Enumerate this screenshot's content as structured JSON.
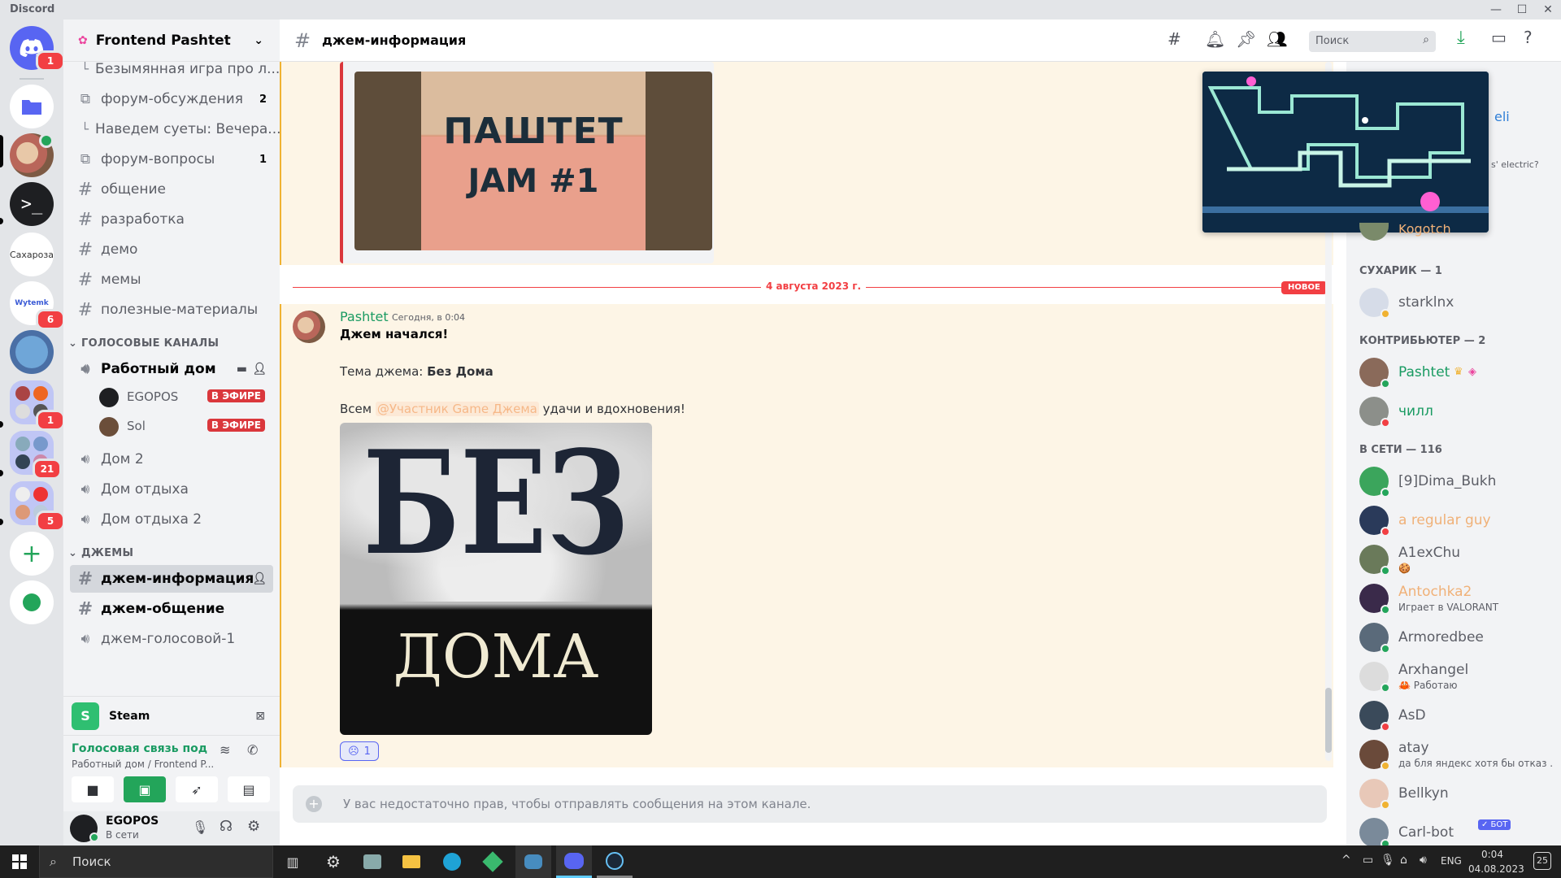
{
  "window": {
    "title": "Discord"
  },
  "rail": {
    "home_badge": "1",
    "servers": [
      {
        "label": "Сахароза"
      },
      {
        "label": "Wytemk",
        "badge": "6"
      }
    ],
    "badges": [
      "1",
      "21",
      "5"
    ]
  },
  "server": {
    "name": "Frontend Pashtet"
  },
  "channels": {
    "top": [
      {
        "icon": "thread",
        "label": "Безымянная игра про л..."
      },
      {
        "icon": "forum",
        "label": "форум-обсуждения",
        "count": "2"
      },
      {
        "icon": "thread",
        "label": "Наведем суеты: Вечера..."
      },
      {
        "icon": "forum",
        "label": "форум-вопросы",
        "count": "1"
      },
      {
        "icon": "text",
        "label": "общение"
      },
      {
        "icon": "text",
        "label": "разработка"
      },
      {
        "icon": "text",
        "label": "демо"
      },
      {
        "icon": "text",
        "label": "мемы"
      },
      {
        "icon": "text",
        "label": "полезные-материалы"
      }
    ],
    "voice_category": "ГОЛОСОВЫЕ КАНАЛЫ",
    "voice": [
      {
        "label": "Работный дом",
        "users": [
          {
            "name": "EGOPOS",
            "status": "В ЭФИРЕ"
          },
          {
            "name": "Sol",
            "status": "В ЭФИРЕ"
          }
        ]
      },
      {
        "label": "Дом 2"
      },
      {
        "label": "Дом отдыха"
      },
      {
        "label": "Дом отдыха 2"
      }
    ],
    "jam_category": "ДЖЕМЫ",
    "jam": [
      {
        "icon": "text",
        "label": "джем-информация",
        "active": true
      },
      {
        "icon": "text",
        "label": "джем-общение"
      },
      {
        "icon": "voice",
        "label": "джем-голосовой-1"
      }
    ]
  },
  "activity": {
    "label": "Steam"
  },
  "voice_panel": {
    "status": "Голосовая связь под",
    "location": "Работный дом / Frontend P..."
  },
  "user": {
    "name": "EGOPOS",
    "status": "В сети"
  },
  "header": {
    "channel": "джем-информация",
    "search_placeholder": "Поиск"
  },
  "messages": {
    "embed_title_line1": "ПАШТЕТ",
    "embed_title_line2": "JAM #1",
    "divider_date": "4 августа 2023 г.",
    "new_label": "НОВОЕ",
    "author": "Pashtet",
    "timestamp": "Сегодня, в 0:04",
    "line1": "Джем начался!",
    "line2_prefix": "Тема джема:",
    "line2_bold": "Без Дома",
    "line3_prefix": "Всем",
    "mention": "@Участник Game Джема",
    "line3_suffix": "удачи и вдохновения!",
    "image_top": "БЕЗ",
    "image_bottom": "ДОМА",
    "reaction_count": "1",
    "input_placeholder": "У вас недостаточно прав, чтобы отправлять сообщения на этом канале."
  },
  "pip": {
    "overlay_name": "eli",
    "overlay_text": "s' electric?",
    "overlay_member": "Kogotch"
  },
  "members": {
    "sections": [
      {
        "title": "СУХАРИК — 1",
        "items": [
          {
            "name": "starklnx",
            "color": "#5c5e66",
            "status": "idle"
          }
        ]
      },
      {
        "title": "КОНТРИБЬЮТЕР — 2",
        "items": [
          {
            "name": "Pashtet",
            "color": "#1a9b62",
            "status": "online"
          },
          {
            "name": "чилл",
            "color": "#1a9b62",
            "status": "dnd"
          }
        ]
      },
      {
        "title": "В СЕТИ — 116",
        "items": [
          {
            "name": "[9]Dima_Bukh",
            "color": "#5c5e66",
            "status": "online"
          },
          {
            "name": "a regular guy",
            "color": "#f0b178",
            "status": "dnd"
          },
          {
            "name": "A1exChu",
            "color": "#5c5e66",
            "status": "online",
            "sub": "🍪"
          },
          {
            "name": "Antochka2",
            "color": "#f0b178",
            "status": "online",
            "sub": "Играет в VALORANT"
          },
          {
            "name": "Armoredbee",
            "color": "#5c5e66",
            "status": "online"
          },
          {
            "name": "Arxhangel",
            "color": "#5c5e66",
            "status": "online",
            "sub": "🦀 Работаю"
          },
          {
            "name": "AsD",
            "color": "#5c5e66",
            "status": "dnd"
          },
          {
            "name": "atay",
            "color": "#5c5e66",
            "status": "idle",
            "sub": "да бля яндекс хотя бы отказ ..."
          },
          {
            "name": "Bellkyn",
            "color": "#5c5e66",
            "status": "idle"
          },
          {
            "name": "Carl-bot",
            "color": "#5c5e66",
            "status": "online",
            "bot": "✓ БОТ"
          }
        ]
      }
    ]
  },
  "taskbar": {
    "search": "Поиск",
    "lang": "ENG",
    "time": "0:04",
    "date": "04.08.2023",
    "notif": "25"
  }
}
